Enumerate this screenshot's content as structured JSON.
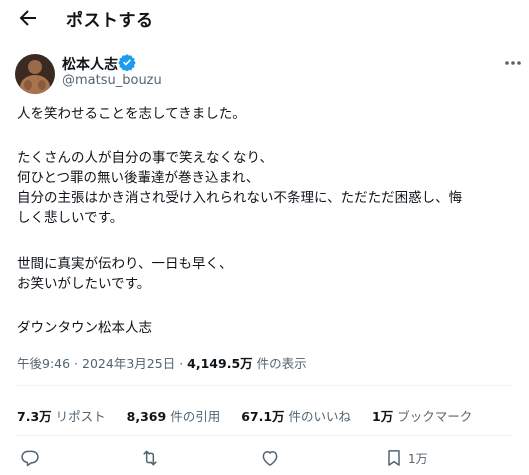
{
  "header": {
    "title": "ポストする"
  },
  "author": {
    "name": "松本人志",
    "handle": "@matsu_bouzu"
  },
  "tweet": {
    "lines": [
      "人を笑わせることを志してきました。",
      "たくさんの人が自分の事で笑えなくなり、",
      "何ひとつ罪の無い後輩達が巻き込まれ、",
      "自分の主張はかき消され受け入れられない不条理に、ただただ困惑し、悔",
      "しく悲しいです。",
      "世間に真実が伝わり、一日も早く、",
      "お笑いがしたいです。",
      "ダウンタウン松本人志"
    ]
  },
  "meta": {
    "time": "午後9:46",
    "date": "2024年3月25日",
    "views": "4,149.5万",
    "views_label": "件の表示",
    "sep": "·"
  },
  "stats": {
    "reposts": "7.3万",
    "reposts_label": "リポスト",
    "quotes": "8,369",
    "quotes_label": "件の引用",
    "likes": "67.1万",
    "likes_label": "件のいいね",
    "bookmarks": "1万",
    "bookmarks_label": "ブックマーク"
  },
  "actions": {
    "bookmark_count": "1万"
  },
  "colors": {
    "verified": "#1d9bf0",
    "text": "#0f1419",
    "secondary": "#536471",
    "divider": "#eff3f4"
  },
  "icons": [
    "back-arrow-icon",
    "verified-badge-icon",
    "more-icon",
    "reply-icon",
    "repost-icon",
    "like-icon",
    "bookmark-icon"
  ]
}
